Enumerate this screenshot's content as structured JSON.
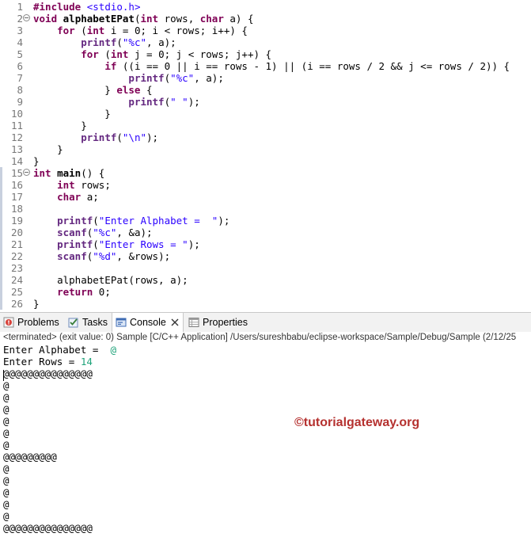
{
  "editor": {
    "lines": [
      {
        "n": "1",
        "html": "<span class=\"pp\">#include</span> <span class=\"inc\">&lt;stdio.h&gt;</span>"
      },
      {
        "n": "2",
        "fold": true,
        "html": "<span class=\"k\">void</span> <span class=\"fn\">alphabetEPat</span>(<span class=\"k\">int</span> rows, <span class=\"k\">char</span> a) {"
      },
      {
        "n": "3",
        "html": "    <span class=\"k\">for</span> (<span class=\"k\">int</span> i = 0; i &lt; rows; i++) {"
      },
      {
        "n": "4",
        "html": "        <span class=\"cl\">printf</span>(<span class=\"s\">\"%c\"</span>, a);"
      },
      {
        "n": "5",
        "html": "        <span class=\"k\">for</span> (<span class=\"k\">int</span> j = 0; j &lt; rows; j++) {"
      },
      {
        "n": "6",
        "html": "            <span class=\"k\">if</span> ((i == 0 || i == rows - 1) || (i == rows / 2 &amp;&amp; j &lt;= rows / 2)) {"
      },
      {
        "n": "7",
        "html": "                <span class=\"cl\">printf</span>(<span class=\"s\">\"%c\"</span>, a);"
      },
      {
        "n": "8",
        "html": "            } <span class=\"k\">else</span> {"
      },
      {
        "n": "9",
        "html": "                <span class=\"cl\">printf</span>(<span class=\"s\">\" \"</span>);"
      },
      {
        "n": "10",
        "html": "            }"
      },
      {
        "n": "11",
        "html": "        }"
      },
      {
        "n": "12",
        "html": "        <span class=\"cl\">printf</span>(<span class=\"s\">\"\\n\"</span>);"
      },
      {
        "n": "13",
        "html": "    }"
      },
      {
        "n": "14",
        "html": "}"
      },
      {
        "n": "15",
        "fold": true,
        "html": "<span class=\"k\">int</span> <span class=\"fn\">main</span>() {"
      },
      {
        "n": "16",
        "html": "    <span class=\"k\">int</span> rows;"
      },
      {
        "n": "17",
        "html": "    <span class=\"k\">char</span> a;"
      },
      {
        "n": "18",
        "html": ""
      },
      {
        "n": "19",
        "html": "    <span class=\"cl\">printf</span>(<span class=\"s\">\"Enter Alphabet =  \"</span>);"
      },
      {
        "n": "20",
        "html": "    <span class=\"cl\">scanf</span>(<span class=\"s\">\"%c\"</span>, &amp;a);"
      },
      {
        "n": "21",
        "html": "    <span class=\"cl\">printf</span>(<span class=\"s\">\"Enter Rows = \"</span>);"
      },
      {
        "n": "22",
        "html": "    <span class=\"cl\">scanf</span>(<span class=\"s\">\"%d\"</span>, &amp;rows);"
      },
      {
        "n": "23",
        "html": ""
      },
      {
        "n": "24",
        "html": "    alphabetEPat(rows, a);"
      },
      {
        "n": "25",
        "html": "    <span class=\"k\">return</span> 0;"
      },
      {
        "n": "26",
        "html": "}"
      }
    ]
  },
  "tabs": {
    "problems": "Problems",
    "tasks": "Tasks",
    "console": "Console",
    "properties": "Properties"
  },
  "console": {
    "header": "<terminated> (exit value: 0) Sample [C/C++ Application] /Users/sureshbabu/eclipse-workspace/Sample/Debug/Sample (2/12/25",
    "prompt_alphabet": "Enter Alphabet =  ",
    "input_alphabet": "@",
    "prompt_rows": "Enter Rows = ",
    "input_rows": "14",
    "output": [
      "@@@@@@@@@@@@@@@",
      "@",
      "@",
      "@",
      "@",
      "@",
      "@",
      "@@@@@@@@@",
      "@",
      "@",
      "@",
      "@",
      "@",
      "@@@@@@@@@@@@@@@"
    ]
  },
  "watermark": "©tutorialgateway.org"
}
